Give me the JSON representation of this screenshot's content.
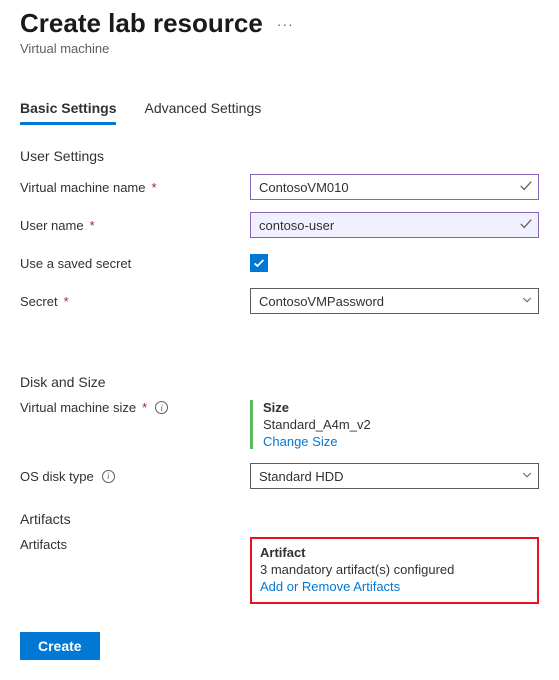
{
  "header": {
    "title": "Create lab resource",
    "subtitle": "Virtual machine",
    "more_actions_glyph": "···"
  },
  "tabs": {
    "basic": "Basic Settings",
    "advanced": "Advanced Settings"
  },
  "sections": {
    "user_settings": "User Settings",
    "disk_and_size": "Disk and Size",
    "artifacts": "Artifacts"
  },
  "fields": {
    "vm_name": {
      "label": "Virtual machine name",
      "value": "ContosoVM010"
    },
    "user_name": {
      "label": "User name",
      "value": "contoso-user"
    },
    "use_saved_secret": {
      "label": "Use a saved secret",
      "checked": true
    },
    "secret": {
      "label": "Secret",
      "value": "ContosoVMPassword"
    },
    "vm_size": {
      "label": "Virtual machine size",
      "block_title": "Size",
      "block_value": "Standard_A4m_v2",
      "change_link": "Change Size"
    },
    "os_disk_type": {
      "label": "OS disk type",
      "value": "Standard HDD"
    },
    "artifacts": {
      "label": "Artifacts",
      "block_title": "Artifact",
      "block_value": "3 mandatory artifact(s) configured",
      "change_link": "Add or Remove Artifacts"
    }
  },
  "footer": {
    "create_label": "Create"
  }
}
